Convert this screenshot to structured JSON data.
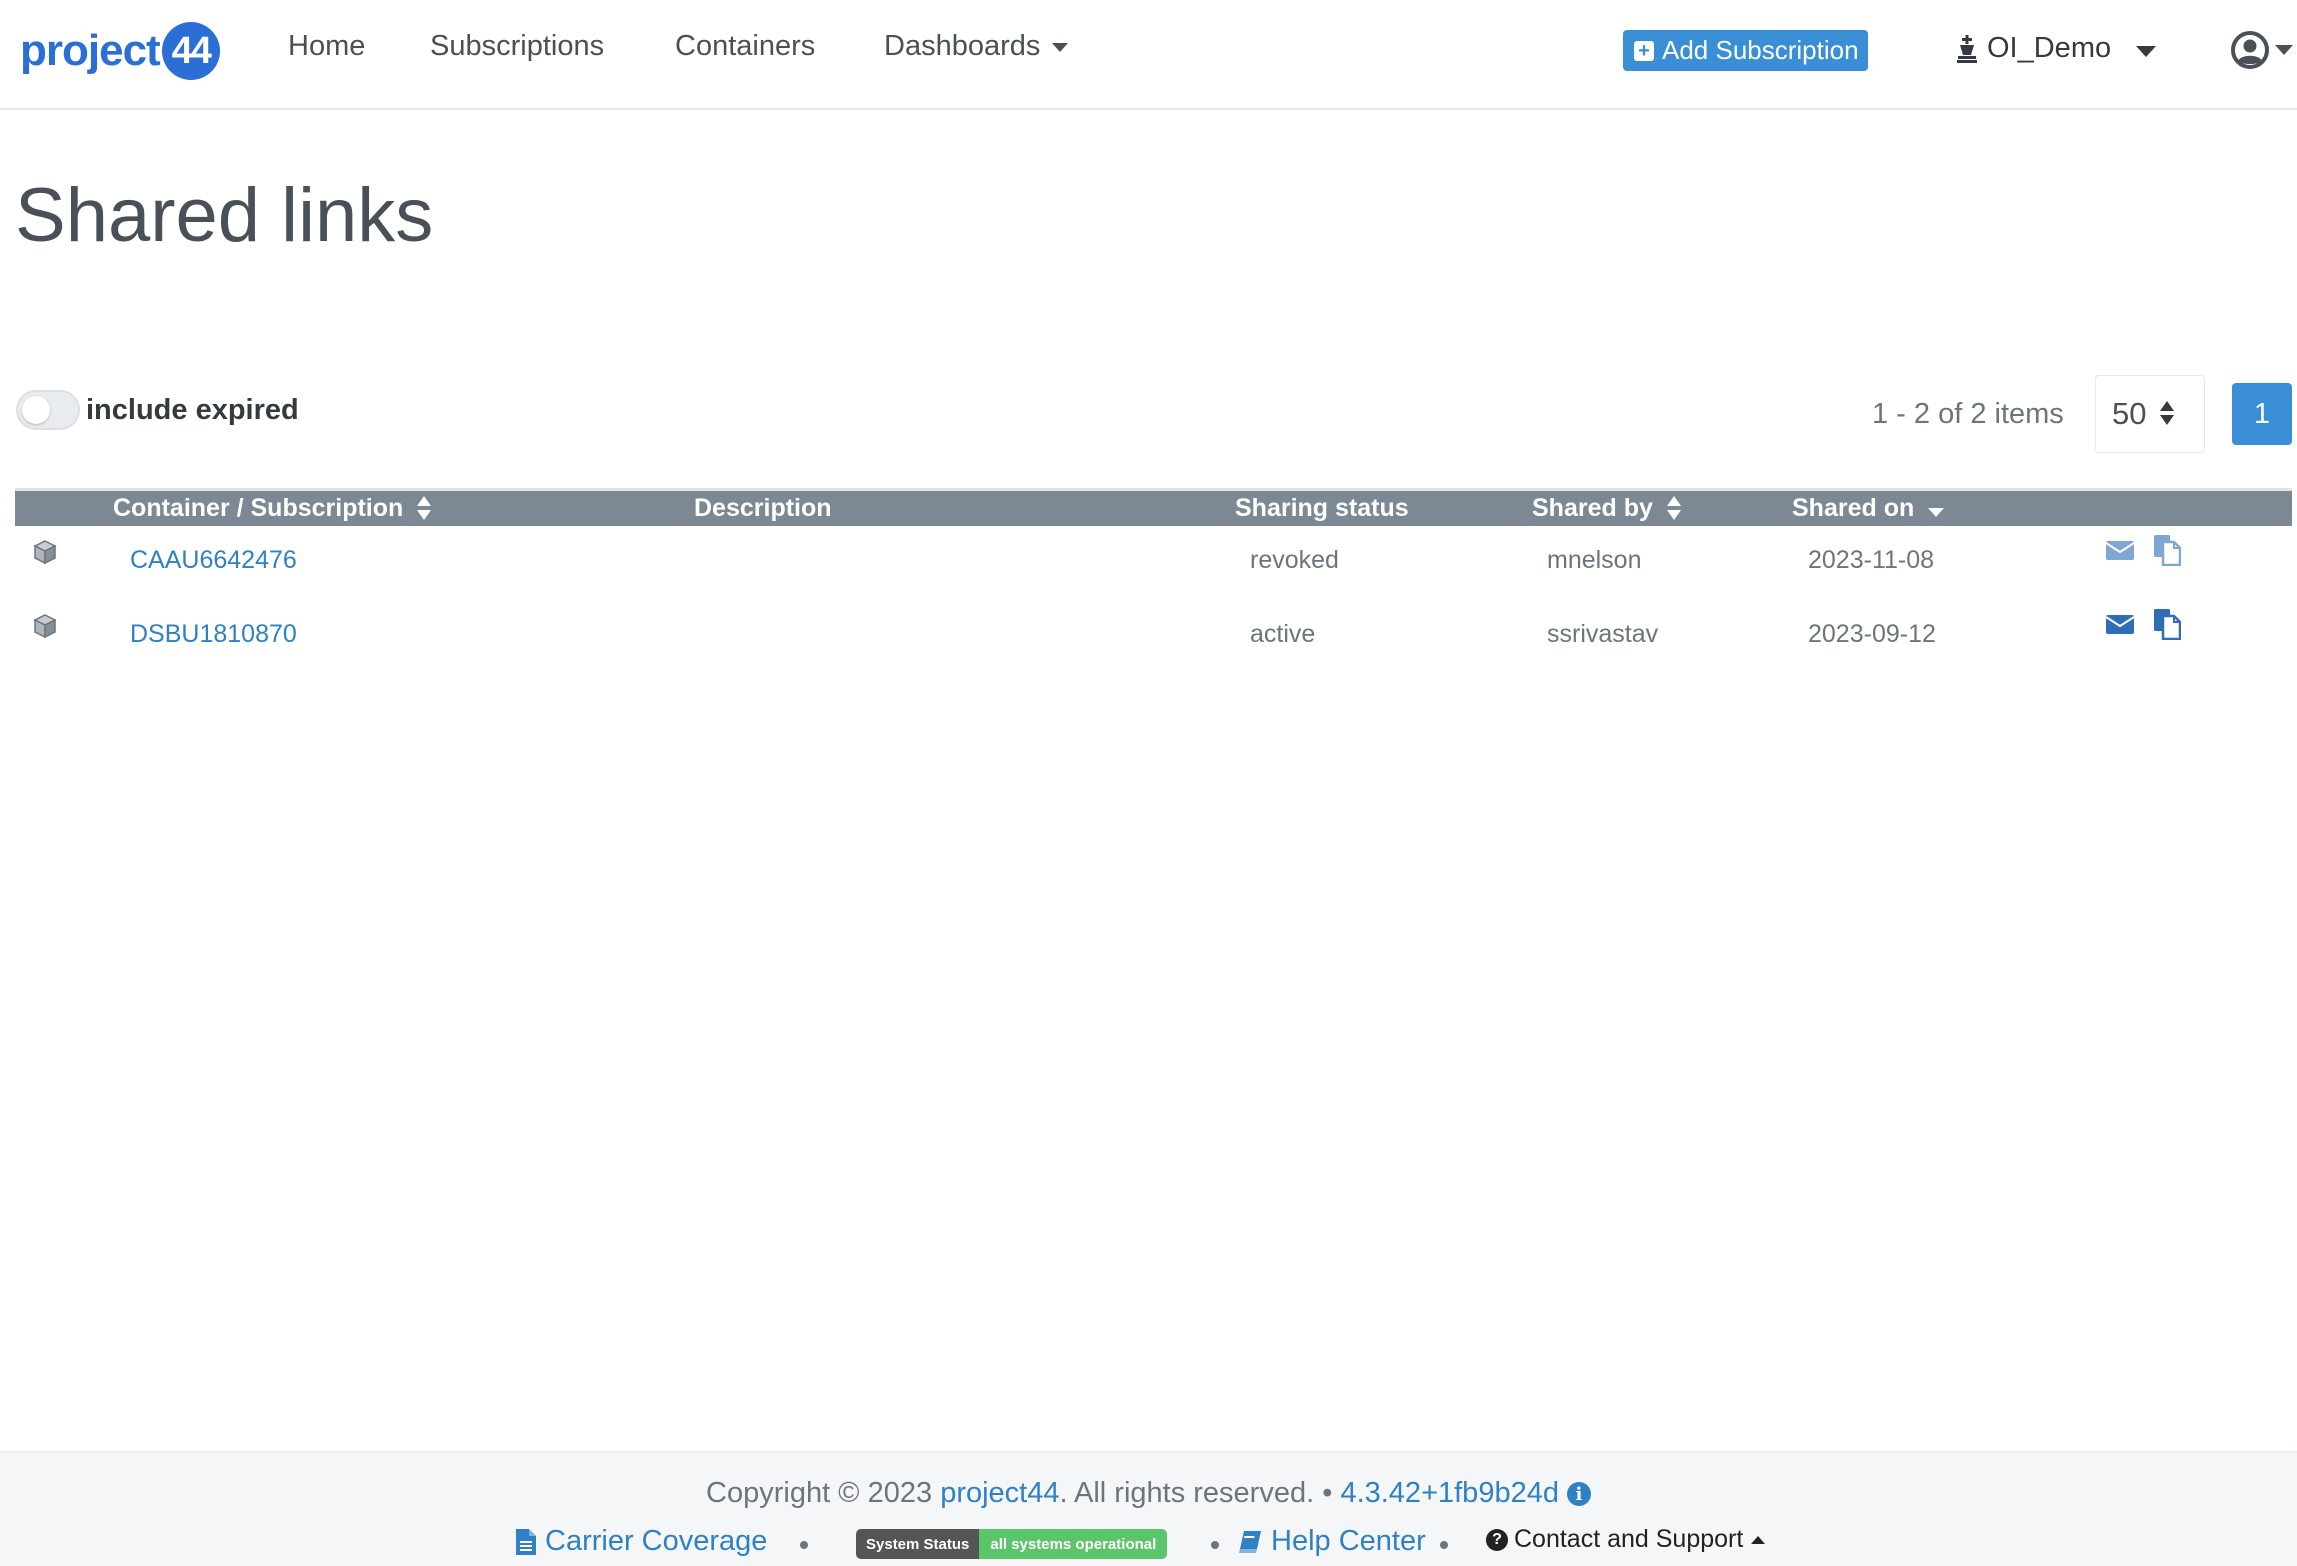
{
  "brand": {
    "logo_text": "project",
    "logo_badge": "44"
  },
  "nav": {
    "home": "Home",
    "subscriptions": "Subscriptions",
    "containers": "Containers",
    "dashboards": "Dashboards",
    "add_subscription": "Add Subscription",
    "org": "OI_Demo"
  },
  "page": {
    "title": "Shared links"
  },
  "filters": {
    "include_expired_label": "include expired",
    "include_expired_on": false
  },
  "pagination": {
    "items_info": "1 - 2 of 2 items",
    "page_size": "50",
    "current_page": "1"
  },
  "table": {
    "columns": {
      "container": "Container / Subscription",
      "description": "Description",
      "status": "Sharing status",
      "shared_by": "Shared by",
      "shared_on": "Shared on"
    },
    "rows": [
      {
        "id": "CAAU6642476",
        "description": "",
        "status": "revoked",
        "shared_by": "mnelson",
        "shared_on": "2023-11-08"
      },
      {
        "id": "DSBU1810870",
        "description": "",
        "status": "active",
        "shared_by": "ssrivastav",
        "shared_on": "2023-09-12"
      }
    ]
  },
  "footer": {
    "copyright_prefix": "Copyright © 2023 ",
    "company": "project44",
    "copyright_suffix": ". All rights reserved. •",
    "version": "4.3.42+1fb9b24d",
    "carrier_coverage": "Carrier Coverage",
    "system_status_label": "System Status",
    "system_status_value": "all systems operational",
    "help_center": "Help Center",
    "contact_support": "Contact and Support"
  },
  "colors": {
    "primary": "#3a8ed6",
    "header_bg": "#7c8893",
    "link": "#2f80c4",
    "status_ok": "#5cc46b"
  },
  "icons": {
    "container": "cube-icon",
    "share_email": "envelope-icon",
    "copy_link": "copy-icon",
    "user": "user-circle-icon",
    "org": "chess-king-icon",
    "document": "file-text-icon",
    "book": "book-icon",
    "question": "question-circle-icon",
    "info": "info-circle-icon"
  }
}
